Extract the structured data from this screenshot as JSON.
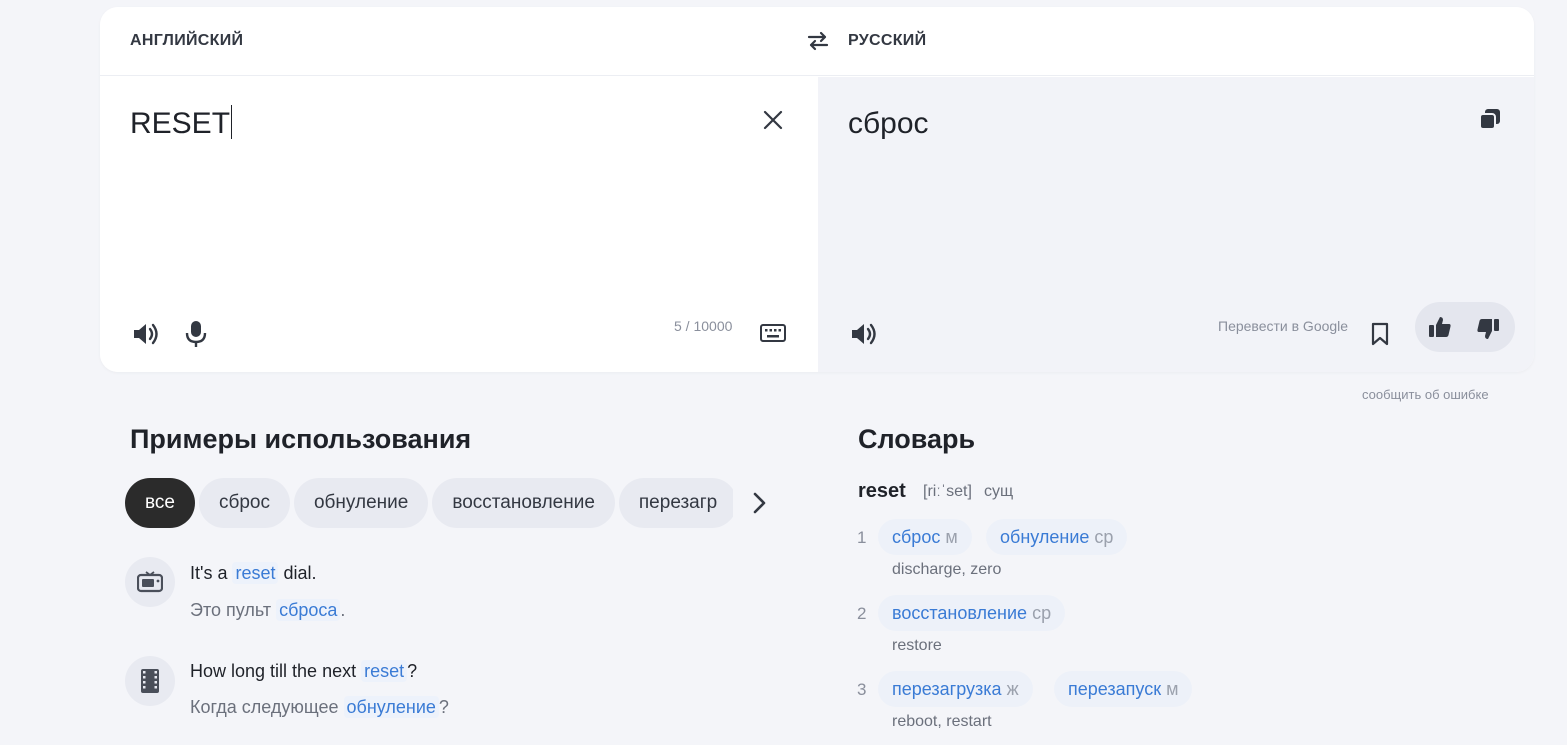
{
  "header": {
    "source_lang": "АНГЛИЙСКИЙ",
    "target_lang": "РУССКИЙ"
  },
  "source": {
    "text": "RESET",
    "counter": "5 / 10000"
  },
  "target": {
    "text": "сброс",
    "google_link": "Перевести в Google"
  },
  "report_error": "сообщить об ошибке",
  "examples": {
    "title": "Примеры использования",
    "chips": [
      "все",
      "сброс",
      "обнуление",
      "восстановление",
      "перезагр"
    ],
    "items": [
      {
        "en_before": "It's a ",
        "en_hl": "reset",
        "en_after": " dial.",
        "ru_before": "Это пульт ",
        "ru_hl": "сброса",
        "ru_after": ".",
        "icon": "tv-icon"
      },
      {
        "en_before": "How long till the next ",
        "en_hl": "reset",
        "en_after": "?",
        "ru_before": "Когда следующее ",
        "ru_hl": "обнуление",
        "ru_after": "?",
        "icon": "film-icon"
      }
    ]
  },
  "dictionary": {
    "title": "Словарь",
    "headword": "reset",
    "transcription": "[riːˈset]",
    "pos": "сущ",
    "senses": [
      {
        "num": "1",
        "translations": [
          {
            "word": "сброс",
            "gender": "м"
          },
          {
            "word": "обнуление",
            "gender": "ср"
          }
        ],
        "gloss": "discharge, zero"
      },
      {
        "num": "2",
        "translations": [
          {
            "word": "восстановление",
            "gender": "ср"
          }
        ],
        "gloss": "restore"
      },
      {
        "num": "3",
        "translations": [
          {
            "word": "перезагрузка",
            "gender": "ж"
          },
          {
            "word": "перезапуск",
            "gender": "м"
          }
        ],
        "gloss": "reboot, restart"
      }
    ]
  },
  "colors": {
    "accent": "#3a7bd5",
    "page_bg": "#f4f5f9",
    "chip_active": "#2b2b2b"
  }
}
